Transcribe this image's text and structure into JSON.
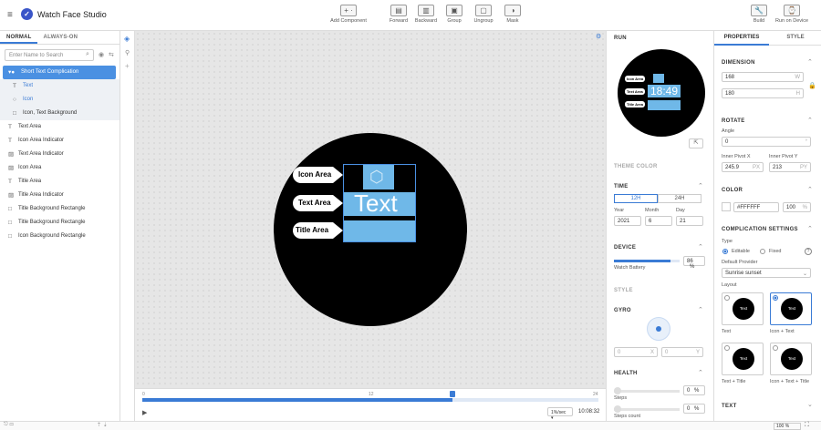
{
  "app": {
    "title": "Watch Face Studio"
  },
  "toolbar": {
    "add_component": "Add Component",
    "forward": "Forward",
    "backward": "Backward",
    "group": "Group",
    "ungroup": "Ungroup",
    "mask": "Mask",
    "build": "Build",
    "run_on_device": "Run on Device"
  },
  "left_panel": {
    "tabs": [
      "NORMAL",
      "ALWAYS-ON"
    ],
    "search_placeholder": "Enter Name to Search",
    "layers": [
      {
        "label": "Short Text Complication",
        "icon": "complication-icon"
      },
      {
        "label": "Text",
        "icon": "text-icon"
      },
      {
        "label": "Icon",
        "icon": "circle-icon"
      },
      {
        "label": "Icon, Text Background",
        "icon": "rectangle-icon"
      },
      {
        "label": "Text Area",
        "icon": "text-icon"
      },
      {
        "label": "Icon Area Indicator",
        "icon": "text-icon"
      },
      {
        "label": "Text Area Indicator",
        "icon": "image-icon"
      },
      {
        "label": "Icon Area",
        "icon": "image-icon"
      },
      {
        "label": "Title Area",
        "icon": "text-icon"
      },
      {
        "label": "Title Area Indicator",
        "icon": "image-icon"
      },
      {
        "label": "Title Background Rectangle",
        "icon": "rectangle-icon"
      },
      {
        "label": "Title Background Rectangle",
        "icon": "rectangle-icon"
      },
      {
        "label": "Icon Background Rectangle",
        "icon": "rectangle-icon"
      }
    ]
  },
  "canvas": {
    "labels": {
      "icon_area": "Icon Area",
      "text_area": "Text Area",
      "title_area": "Title Area"
    },
    "text_preview": "Text"
  },
  "timeline": {
    "ticks": [
      "0",
      "12",
      "24"
    ],
    "speed": "1%/sec",
    "time": "10:08:32",
    "progress": 0.68
  },
  "run_panel": {
    "title": "RUN",
    "preview_time": "18:49",
    "preview_labels": {
      "icon_area": "Icon Area",
      "text_area": "Text Area",
      "title_area": "Title Area"
    },
    "theme_color": "THEME COLOR",
    "time": {
      "header": "TIME",
      "h12": "12H",
      "h24": "24H",
      "year_label": "Year",
      "month_label": "Month",
      "day_label": "Day",
      "year": "2021",
      "month": "6",
      "day": "21"
    },
    "device": {
      "header": "DEVICE",
      "battery_label": "Watch Battery",
      "battery": "86",
      "battery_unit": "%"
    },
    "style": "STYLE",
    "gyro": {
      "header": "GYRO",
      "x": "0",
      "y": "0",
      "x_label": "X",
      "y_label": "Y"
    },
    "health": {
      "header": "HEALTH",
      "steps_label": "Steps",
      "steps": "0",
      "steps_count_label": "Steps count",
      "steps_count": "0",
      "unit": "%"
    }
  },
  "props_panel": {
    "tabs": [
      "PROPERTIES",
      "STYLE"
    ],
    "dimension": {
      "header": "DIMENSION",
      "w": "168",
      "h": "180",
      "w_label": "W",
      "h_label": "H"
    },
    "rotate": {
      "header": "ROTATE",
      "angle_label": "Angle",
      "angle": "0",
      "angle_unit": "°",
      "pivot_x_label": "Inner Pivot X",
      "pivot_y_label": "Inner Pivot Y",
      "pivot_x": "245.9",
      "pivot_y": "213",
      "px_unit": "PX",
      "py_unit": "PY"
    },
    "color": {
      "header": "COLOR",
      "hex": "#FFFFFF",
      "opacity": "100",
      "unit": "%"
    },
    "complication": {
      "header": "COMPLICATION SETTINGS",
      "type_label": "Type",
      "editable": "Editable",
      "fixed": "Fixed",
      "provider_label": "Default Provider",
      "provider": "Sunrise sunset",
      "layout_label": "Layout",
      "layouts": [
        {
          "caption": "Text",
          "inner": "Text"
        },
        {
          "caption": "Icon + Text",
          "inner": "Text"
        },
        {
          "caption": "Text + Title",
          "inner": "Text"
        },
        {
          "caption": "Icon + Text + Title",
          "inner": "Text"
        }
      ]
    },
    "text": {
      "header": "TEXT"
    }
  },
  "status": {
    "zoom": "100",
    "unit": "%"
  },
  "colors": {
    "accent": "#3a7bd5",
    "highlight": "#4a90e2",
    "area_fill": "#6fb8e8"
  }
}
